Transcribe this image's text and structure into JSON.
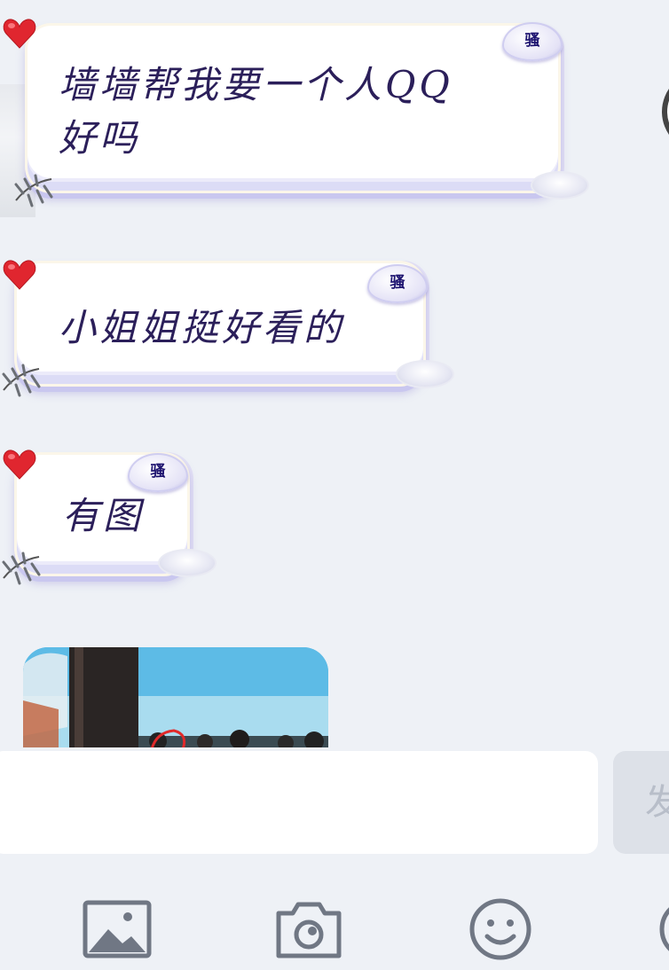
{
  "messages": [
    {
      "text_line1": "墙墙帮我要一个人QQ",
      "text_line2": "好吗",
      "tag": "骚"
    },
    {
      "text": "小姐姐挺好看的",
      "tag": "骚"
    },
    {
      "text": "有图",
      "tag": "骚"
    }
  ],
  "photo_message": {
    "icon": "image-thumbnail"
  },
  "composer": {
    "input_value": "",
    "send_label": "发"
  },
  "toolbar": {
    "items": [
      "image-icon",
      "camera-icon",
      "emoji-icon",
      "more-icon"
    ]
  },
  "colors": {
    "background": "#eef1f6",
    "bubble_text": "#2b1f5a",
    "heart": "#e0262f",
    "tag_text": "#1e1470",
    "toolbar_icon": "#707784"
  }
}
